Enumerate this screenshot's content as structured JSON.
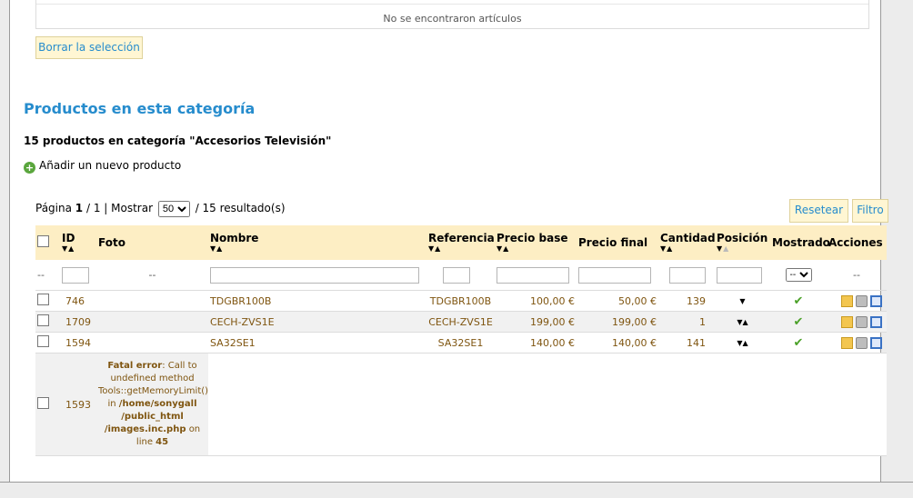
{
  "top_box": {
    "empty_message": "No se encontraron artículos"
  },
  "clear_selection_label": "Borrar la selección",
  "section_title": "Productos en esta categoría",
  "category_summary": "15 productos en categoría \"Accesorios Televisión\"",
  "add_product_label": "Añadir un nuevo producto",
  "pager": {
    "page_label": "Página",
    "page_current": "1",
    "page_sep": "/ 1 | Mostrar",
    "per_page": "50",
    "results": "/ 15 resultado(s)"
  },
  "buttons": {
    "reset": "Resetear",
    "filter": "Filtro"
  },
  "columns": {
    "id": "ID",
    "photo": "Foto",
    "name": "Nombre",
    "reference": "Referencia",
    "base_price": "Precio base",
    "final_price": "Precio final",
    "quantity": "Cantidad",
    "position": "Posición",
    "shown": "Mostrado",
    "actions": "Acciones"
  },
  "filters": {
    "dash": "--",
    "shown_select": "--"
  },
  "rows": [
    {
      "id": "746",
      "name": "TDGBR100B",
      "reference": "TDGBR100B",
      "base_price": "100,00 €",
      "final_price": "50,00 €",
      "quantity": "139"
    },
    {
      "id": "1709",
      "name": "CECH-ZVS1E",
      "reference": "CECH-ZVS1E",
      "base_price": "199,00 €",
      "final_price": "199,00 €",
      "quantity": "1"
    },
    {
      "id": "1594",
      "name": "SA32SE1",
      "reference": "SA32SE1",
      "base_price": "140,00 €",
      "final_price": "140,00 €",
      "quantity": "141"
    }
  ],
  "error_row": {
    "id": "1593",
    "label": "Fatal error",
    "text1": ": Call to undefined method Tools::getMemoryLimit() in",
    "path": "/home/sonygall /public_html /images.inc.php",
    "text2": "on line",
    "line": "45"
  },
  "icons": {
    "check": "check-icon",
    "edit": "edit-icon",
    "delete": "trash-icon",
    "duplicate": "duplicate-icon",
    "add": "add-icon"
  }
}
